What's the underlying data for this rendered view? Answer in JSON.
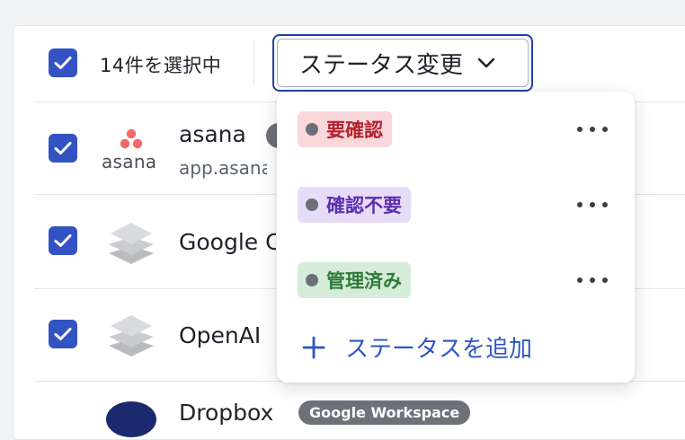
{
  "toolbar": {
    "selected_count": "14件を選択中",
    "status_change_label": "ステータス変更"
  },
  "apps": [
    {
      "name": "asana",
      "url": "app.asana",
      "icon": "asana-logo",
      "logo_text": "asana",
      "badge": ""
    },
    {
      "name": "Google C",
      "url": "",
      "icon": "stack-layers-icon",
      "badge": ""
    },
    {
      "name": "OpenAI",
      "url": "",
      "icon": "stack-layers-icon",
      "badge": ""
    },
    {
      "name": "Dropbox",
      "url": "",
      "icon": "dropbox-logo",
      "badge": "Google Workspace"
    }
  ],
  "status_menu": {
    "options": [
      {
        "label": "要確認",
        "bg": "#f9d7da",
        "fg": "#b4232f"
      },
      {
        "label": "確認不要",
        "bg": "#e7dcf8",
        "fg": "#5c2eb0"
      },
      {
        "label": "管理済み",
        "bg": "#d5ecd8",
        "fg": "#2f7a3a"
      }
    ],
    "add_label": "ステータスを追加"
  },
  "colors": {
    "accent": "#3352c4",
    "focus_ring": "#2440a8",
    "link": "#2e54c8"
  }
}
